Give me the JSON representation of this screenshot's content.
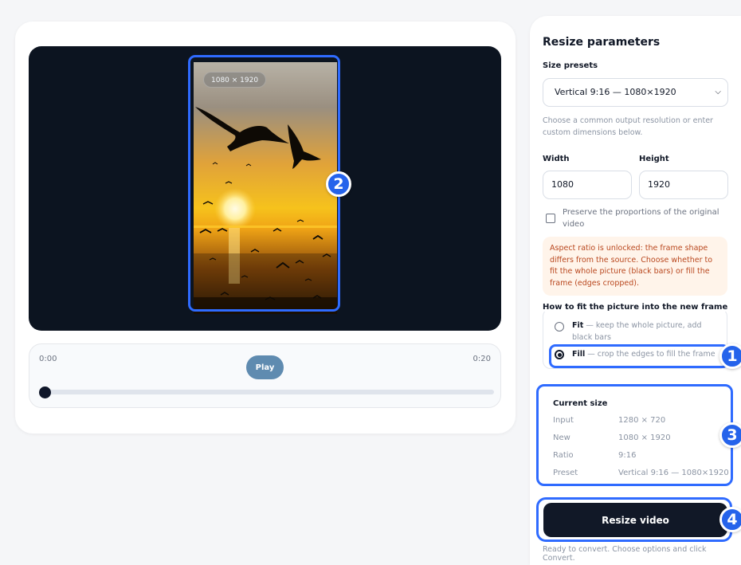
{
  "preview": {
    "dimension_badge": "1080 × 1920"
  },
  "player": {
    "time_start": "0:00",
    "time_end": "0:20",
    "play_label": "Play",
    "progress_fraction": 0
  },
  "panel": {
    "title": "Resize parameters",
    "size_presets_label": "Size presets",
    "size_preset_value": "Vertical 9:16 — 1080×1920",
    "size_presets_hint": "Choose a common output resolution or enter custom dimensions below.",
    "width_label": "Width",
    "width_value": "1080",
    "height_label": "Height",
    "height_value": "1920",
    "preserve_label": "Preserve the proportions of the original video",
    "preserve_checked": false,
    "aspect_warning": "Aspect ratio is unlocked: the frame shape differs from the source. Choose whether to fit the whole picture (black bars) or fill the frame (edges cropped).",
    "fit_group_label": "How to fit the picture into the new frame",
    "fit_option": {
      "name": "Fit",
      "desc": " — keep the whole picture, add black bars"
    },
    "fill_option": {
      "name": "Fill",
      "desc": " — crop the edges to fill the frame"
    },
    "selected_fit_mode": "Fill"
  },
  "current_size": {
    "title": "Current size",
    "rows": [
      {
        "key": "Input",
        "value": "1280 × 720"
      },
      {
        "key": "New",
        "value": "1080 × 1920"
      },
      {
        "key": "Ratio",
        "value": "9:16"
      },
      {
        "key": "Preset",
        "value": "Vertical 9:16 — 1080×1920"
      }
    ]
  },
  "actions": {
    "resize_label": "Resize video",
    "status": "Ready to convert. Choose options and click Convert."
  },
  "markers": [
    "1",
    "2",
    "3",
    "4"
  ],
  "colors": {
    "highlight": "#2f6bff",
    "marker": "#2563eb",
    "primary_button": "#111827",
    "play_button": "#5f8bb0",
    "stage": "#0c1420",
    "warning_bg": "#fff4ea",
    "warning_text": "#b9471e"
  },
  "icons": {
    "select_chevron": "chevron-down-icon"
  }
}
